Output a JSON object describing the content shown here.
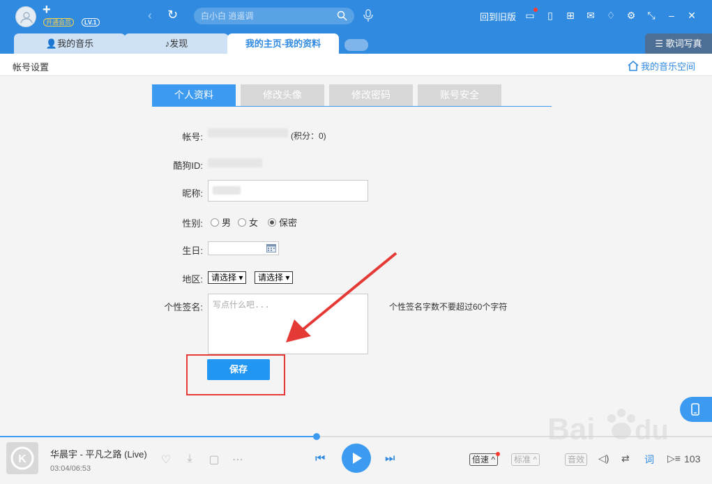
{
  "header": {
    "plus": "+",
    "vip_badge": "开通会员",
    "level": "LV.1",
    "search_placeholder": "白小白 逍遥调",
    "old_version": "回到旧版"
  },
  "tabs": [
    {
      "label": "我的音乐",
      "icon": "person-icon"
    },
    {
      "label": "发现",
      "icon": "music-note-icon"
    },
    {
      "label": "我的主页-我的资料",
      "active": true
    }
  ],
  "lyrics_button": "歌词写真",
  "subbar": {
    "title": "帐号设置",
    "space_link": "我的音乐空间"
  },
  "profile_tabs": [
    {
      "label": "个人资料",
      "active": true
    },
    {
      "label": "修改头像"
    },
    {
      "label": "修改密码"
    },
    {
      "label": "账号安全"
    }
  ],
  "form": {
    "account_label": "帐号:",
    "score": "(积分：0)",
    "kugou_id_label": "酷狗ID:",
    "nickname_label": "昵称:",
    "gender_label": "性别:",
    "gender_options": [
      "男",
      "女",
      "保密"
    ],
    "gender_selected": "保密",
    "birthday_label": "生日:",
    "region_label": "地区:",
    "region_select_1": "请选择 ▾",
    "region_select_2": "请选择 ▾",
    "signature_label": "个性签名:",
    "signature_placeholder": "写点什么吧...",
    "signature_hint": "个性签名字数不要超过60个字符",
    "save_button": "保存"
  },
  "player": {
    "song": "华晨宇 - 平凡之路 (Live)",
    "time": "03:04/06:53",
    "progress": 0.445,
    "speed_button": "倍速",
    "quality_button": "标准",
    "sound_button": "音效",
    "lyrics_toggle": "词",
    "playlist_count": "103"
  },
  "colors": {
    "brand": "#2f8ae0",
    "accent": "#3c9bf0",
    "annotation": "#e53935"
  }
}
